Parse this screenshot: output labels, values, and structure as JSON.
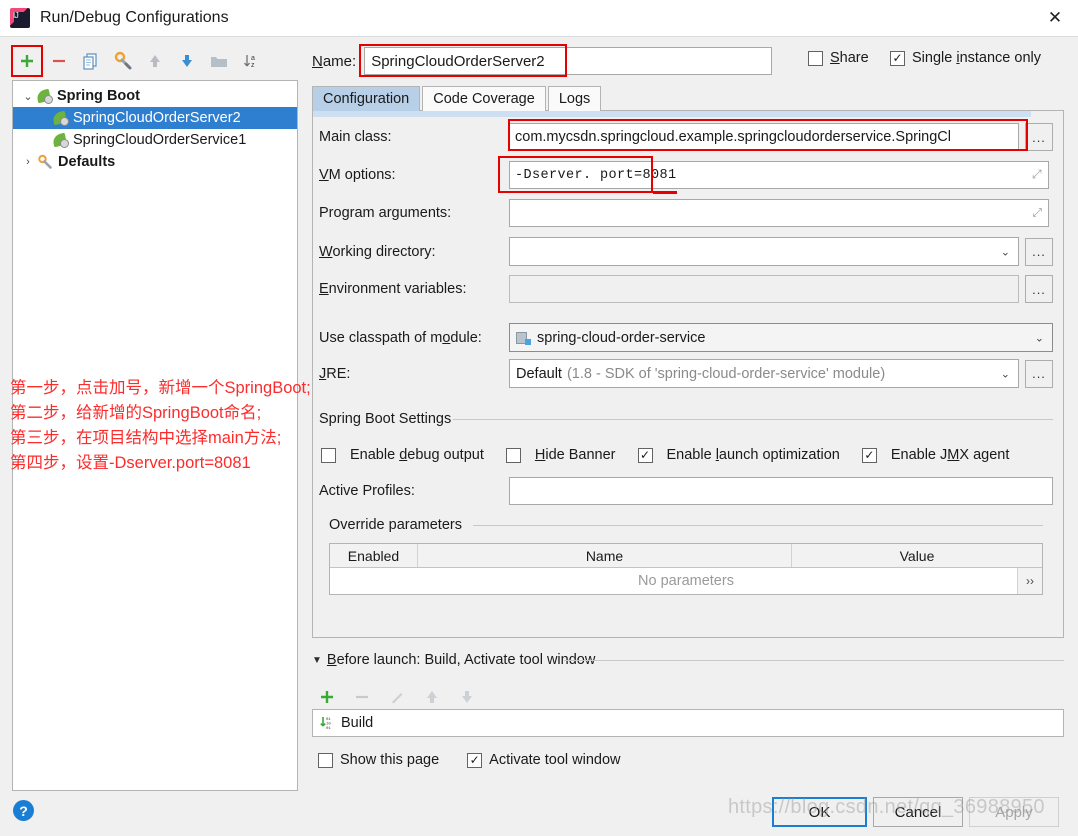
{
  "window": {
    "title": "Run/Debug Configurations",
    "close_label": "✕",
    "app_icon": "intellij-idea-logo"
  },
  "toolbar": {
    "buttons": [
      {
        "name": "add",
        "glyph": "+",
        "highlighted": true
      },
      {
        "name": "remove",
        "glyph": "−",
        "highlighted": false
      },
      {
        "name": "copy",
        "glyph": "copy-icon",
        "highlighted": false
      },
      {
        "name": "edit-templates",
        "glyph": "wrench-icon",
        "highlighted": false
      },
      {
        "name": "move-up",
        "glyph": "↑",
        "highlighted": false
      },
      {
        "name": "move-down",
        "glyph": "↓",
        "highlighted": false
      },
      {
        "name": "folder",
        "glyph": "folder-icon",
        "highlighted": false
      },
      {
        "name": "sort-alphabetically",
        "glyph": "sort-az-icon",
        "highlighted": false
      }
    ]
  },
  "tree": {
    "nodes": [
      {
        "label": "Spring Boot",
        "level": 0,
        "expanded": true,
        "twisty": "⌄",
        "icon": "spring-icon",
        "bold": true,
        "selected": false
      },
      {
        "label": "SpringCloudOrderServer2",
        "level": 1,
        "expanded": null,
        "twisty": "",
        "icon": "spring-icon",
        "bold": false,
        "selected": true
      },
      {
        "label": "SpringCloudOrderService1",
        "level": 1,
        "expanded": null,
        "twisty": "",
        "icon": "spring-icon",
        "bold": false,
        "selected": false
      },
      {
        "label": "Defaults",
        "level": 0,
        "expanded": false,
        "twisty": "›",
        "icon": "wrench-icon",
        "bold": true,
        "selected": false
      }
    ]
  },
  "annotation": {
    "color": "#fc2c2c",
    "lines": [
      "第一步，点击加号，新增一个SpringBoot;",
      "第二步，给新增的SpringBoot命名;",
      "第三步，在项目结构中选择main方法;",
      "第四步，设置-Dserver.port=8081"
    ]
  },
  "name_row": {
    "label": "Name:",
    "label_mnemonic": "N",
    "value": "SpringCloudOrderServer2",
    "share": {
      "label": "Share",
      "mnemonic": "S",
      "checked": false
    },
    "single_instance": {
      "label": "Single instance only",
      "mnemonic": "i",
      "checked": true
    }
  },
  "tabs": [
    {
      "label": "Configuration",
      "active": true
    },
    {
      "label": "Code Coverage",
      "active": false
    },
    {
      "label": "Logs",
      "active": false
    }
  ],
  "configuration": {
    "main_class": {
      "label": "Main class:",
      "value": "com.mycsdn.springcloud.example.springcloudorderservice.SpringCl",
      "browse": "..."
    },
    "vm_options": {
      "label": "VM options:",
      "mnemonic": "V",
      "value": "-Dserver. port=8081",
      "expand": "⤢"
    },
    "program_arguments": {
      "label": "Program arguments:",
      "mnemonic": "g",
      "value": "",
      "expand": "⤢"
    },
    "working_directory": {
      "label": "Working directory:",
      "mnemonic": "W",
      "value": "",
      "browse": "..."
    },
    "environment_variables": {
      "label": "Environment variables:",
      "mnemonic": "E",
      "value": "",
      "browse": "..."
    },
    "classpath_module": {
      "label": "Use classpath of module:",
      "mnemonic": "o",
      "value": "spring-cloud-order-service",
      "icon": "module-icon"
    },
    "jre": {
      "label": "JRE:",
      "mnemonic": "J",
      "value": "Default",
      "value_hint": "(1.8 - SDK of 'spring-cloud-order-service' module)",
      "browse": "..."
    },
    "spring_boot_settings": {
      "title": "Spring Boot Settings",
      "checkboxes": [
        {
          "label": "Enable debug output",
          "mnemonic": "d",
          "checked": false
        },
        {
          "label": "Hide Banner",
          "mnemonic": "H",
          "checked": false
        },
        {
          "label": "Enable launch optimization",
          "mnemonic": "l",
          "checked": true
        },
        {
          "label": "Enable JMX agent",
          "mnemonic": "M",
          "checked": true
        }
      ],
      "active_profiles": {
        "label": "Active Profiles:",
        "value": ""
      }
    },
    "override_parameters": {
      "title": "Override parameters",
      "columns": [
        "Enabled",
        "Name",
        "Value"
      ],
      "empty_text": "No parameters",
      "more_glyph": "››"
    }
  },
  "before_launch": {
    "title": "Before launch: Build, Activate tool window",
    "mnemonic": "B",
    "collapse_glyph": "▼",
    "toolbar": [
      {
        "name": "add",
        "glyph": "+",
        "enabled": true
      },
      {
        "name": "remove",
        "glyph": "−",
        "enabled": false
      },
      {
        "name": "edit",
        "glyph": "✎",
        "enabled": false
      },
      {
        "name": "move-up",
        "glyph": "↑",
        "enabled": false
      },
      {
        "name": "move-down",
        "glyph": "↓",
        "enabled": false
      }
    ],
    "items": [
      {
        "label": "Build",
        "icon": "build-icon"
      }
    ],
    "checkboxes": [
      {
        "label": "Show this page",
        "checked": false
      },
      {
        "label": "Activate tool window",
        "checked": true
      }
    ]
  },
  "footer": {
    "help_glyph": "?",
    "ok": {
      "label": "OK",
      "primary": true,
      "enabled": true
    },
    "cancel": {
      "label": "Cancel",
      "primary": false,
      "enabled": true
    },
    "apply": {
      "label": "Apply",
      "primary": false,
      "enabled": false
    }
  },
  "watermark": "https://blog.csdn.net/qq_36988950"
}
